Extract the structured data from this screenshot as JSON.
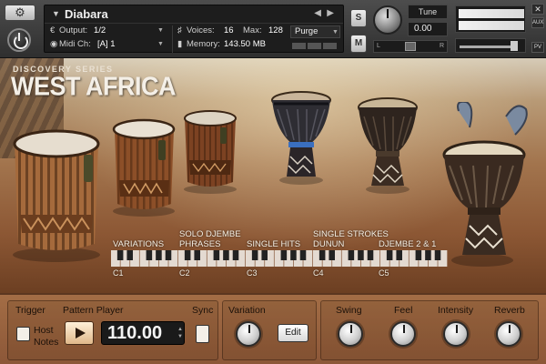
{
  "header": {
    "instrument_name": "Diabara",
    "output_label": "Output:",
    "output_value": "1/2",
    "voices_label": "Voices:",
    "voices_value": "16",
    "max_label": "Max:",
    "max_value": "128",
    "purge_label": "Purge",
    "midi_label": "Midi Ch:",
    "midi_value": "[A]  1",
    "memory_label": "Memory:",
    "memory_value": "143.50 MB",
    "s_label": "S",
    "m_label": "M",
    "tune_label": "Tune",
    "tune_value": "0.00",
    "pan_left": "L",
    "pan_right": "R",
    "aux_label": "AUX",
    "pv_label": "PV"
  },
  "branding": {
    "series": "DISCOVERY SERIES",
    "product": "WEST AFRICA"
  },
  "sections": [
    {
      "label": "VARIATIONS"
    },
    {
      "label": "SOLO DJEMBE"
    },
    {
      "label": "PHRASES"
    },
    {
      "label": "SINGLE HITS"
    },
    {
      "label": "SINGLE STROKES"
    },
    {
      "label": "DUNUN"
    },
    {
      "label": "DJEMBE 2 & 1"
    }
  ],
  "octaves": [
    "C1",
    "C2",
    "C3",
    "C4",
    "C5"
  ],
  "controls": {
    "trigger_label": "Trigger",
    "trigger_option_1": "Host",
    "trigger_option_2": "Notes",
    "pattern_player_label": "Pattern Player",
    "tempo": "110.00",
    "sync_label": "Sync",
    "variation_label": "Variation",
    "edit_label": "Edit",
    "swing_label": "Swing",
    "feel_label": "Feel",
    "intensity_label": "Intensity",
    "reverb_label": "Reverb"
  },
  "icons": {
    "settings": "gear-icon",
    "power": "power-icon",
    "play": "play-icon",
    "dropdown": "triangle-down-icon"
  },
  "colors": {
    "panel_wood": "#a36d45",
    "display_bg": "#1d1d1d",
    "text_light": "#f4efe7"
  }
}
